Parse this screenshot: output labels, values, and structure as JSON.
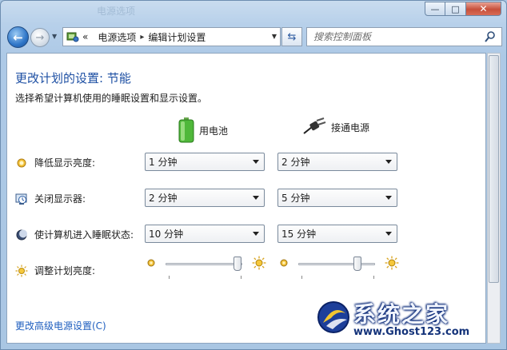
{
  "window": {
    "title_ghost": "电源选项",
    "minimize_glyph": "—",
    "maximize_glyph": "□",
    "close_glyph": "✕"
  },
  "nav": {
    "back_glyph": "←",
    "forward_glyph": "→",
    "history_glyph": "▼",
    "breadcrumb_overflow": "«",
    "crumbs": [
      "电源选项",
      "编辑计划设置"
    ],
    "crumb_separator": "▸",
    "refresh_glyph": "⇆",
    "search_placeholder": "搜索控制面板"
  },
  "page": {
    "title": "更改计划的设置: 节能",
    "subtitle": "选择希望计算机使用的睡眠设置和显示设置。"
  },
  "columns": {
    "battery": "用电池",
    "plugged_in": "接通电源"
  },
  "rows": [
    {
      "label": "降低显示亮度:",
      "battery": "1 分钟",
      "plugged_in": "2 分钟",
      "icon": "dim-display-icon"
    },
    {
      "label": "关闭显示器:",
      "battery": "2 分钟",
      "plugged_in": "5 分钟",
      "icon": "display-off-icon"
    },
    {
      "label": "使计算机进入睡眠状态:",
      "battery": "10 分钟",
      "plugged_in": "15 分钟",
      "icon": "sleep-icon"
    }
  ],
  "brightness": {
    "label": "调整计划亮度:",
    "battery_level": 0.94,
    "plugged_in_level": 0.77
  },
  "links": {
    "advanced": "更改高级电源设置(C)"
  },
  "watermark": {
    "title": "系统之家",
    "url": "www.Ghost123.com"
  },
  "colors": {
    "title_blue": "#1d4fa3",
    "link_blue": "#1e5ebf"
  }
}
